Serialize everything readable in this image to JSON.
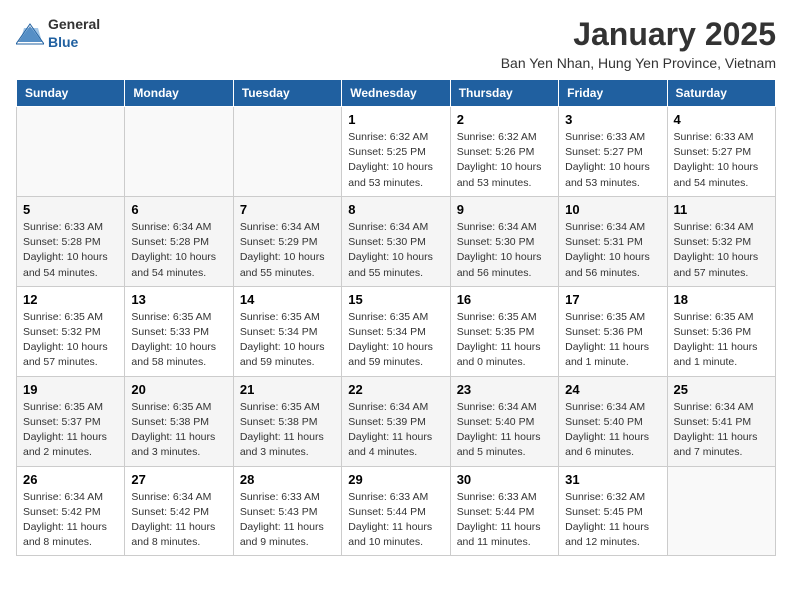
{
  "header": {
    "logo_general": "General",
    "logo_blue": "Blue",
    "month_title": "January 2025",
    "location": "Ban Yen Nhan, Hung Yen Province, Vietnam"
  },
  "days_of_week": [
    "Sunday",
    "Monday",
    "Tuesday",
    "Wednesday",
    "Thursday",
    "Friday",
    "Saturday"
  ],
  "weeks": [
    [
      {
        "day": "",
        "detail": ""
      },
      {
        "day": "",
        "detail": ""
      },
      {
        "day": "",
        "detail": ""
      },
      {
        "day": "1",
        "detail": "Sunrise: 6:32 AM\nSunset: 5:25 PM\nDaylight: 10 hours\nand 53 minutes."
      },
      {
        "day": "2",
        "detail": "Sunrise: 6:32 AM\nSunset: 5:26 PM\nDaylight: 10 hours\nand 53 minutes."
      },
      {
        "day": "3",
        "detail": "Sunrise: 6:33 AM\nSunset: 5:27 PM\nDaylight: 10 hours\nand 53 minutes."
      },
      {
        "day": "4",
        "detail": "Sunrise: 6:33 AM\nSunset: 5:27 PM\nDaylight: 10 hours\nand 54 minutes."
      }
    ],
    [
      {
        "day": "5",
        "detail": "Sunrise: 6:33 AM\nSunset: 5:28 PM\nDaylight: 10 hours\nand 54 minutes."
      },
      {
        "day": "6",
        "detail": "Sunrise: 6:34 AM\nSunset: 5:28 PM\nDaylight: 10 hours\nand 54 minutes."
      },
      {
        "day": "7",
        "detail": "Sunrise: 6:34 AM\nSunset: 5:29 PM\nDaylight: 10 hours\nand 55 minutes."
      },
      {
        "day": "8",
        "detail": "Sunrise: 6:34 AM\nSunset: 5:30 PM\nDaylight: 10 hours\nand 55 minutes."
      },
      {
        "day": "9",
        "detail": "Sunrise: 6:34 AM\nSunset: 5:30 PM\nDaylight: 10 hours\nand 56 minutes."
      },
      {
        "day": "10",
        "detail": "Sunrise: 6:34 AM\nSunset: 5:31 PM\nDaylight: 10 hours\nand 56 minutes."
      },
      {
        "day": "11",
        "detail": "Sunrise: 6:34 AM\nSunset: 5:32 PM\nDaylight: 10 hours\nand 57 minutes."
      }
    ],
    [
      {
        "day": "12",
        "detail": "Sunrise: 6:35 AM\nSunset: 5:32 PM\nDaylight: 10 hours\nand 57 minutes."
      },
      {
        "day": "13",
        "detail": "Sunrise: 6:35 AM\nSunset: 5:33 PM\nDaylight: 10 hours\nand 58 minutes."
      },
      {
        "day": "14",
        "detail": "Sunrise: 6:35 AM\nSunset: 5:34 PM\nDaylight: 10 hours\nand 59 minutes."
      },
      {
        "day": "15",
        "detail": "Sunrise: 6:35 AM\nSunset: 5:34 PM\nDaylight: 10 hours\nand 59 minutes."
      },
      {
        "day": "16",
        "detail": "Sunrise: 6:35 AM\nSunset: 5:35 PM\nDaylight: 11 hours\nand 0 minutes."
      },
      {
        "day": "17",
        "detail": "Sunrise: 6:35 AM\nSunset: 5:36 PM\nDaylight: 11 hours\nand 1 minute."
      },
      {
        "day": "18",
        "detail": "Sunrise: 6:35 AM\nSunset: 5:36 PM\nDaylight: 11 hours\nand 1 minute."
      }
    ],
    [
      {
        "day": "19",
        "detail": "Sunrise: 6:35 AM\nSunset: 5:37 PM\nDaylight: 11 hours\nand 2 minutes."
      },
      {
        "day": "20",
        "detail": "Sunrise: 6:35 AM\nSunset: 5:38 PM\nDaylight: 11 hours\nand 3 minutes."
      },
      {
        "day": "21",
        "detail": "Sunrise: 6:35 AM\nSunset: 5:38 PM\nDaylight: 11 hours\nand 3 minutes."
      },
      {
        "day": "22",
        "detail": "Sunrise: 6:34 AM\nSunset: 5:39 PM\nDaylight: 11 hours\nand 4 minutes."
      },
      {
        "day": "23",
        "detail": "Sunrise: 6:34 AM\nSunset: 5:40 PM\nDaylight: 11 hours\nand 5 minutes."
      },
      {
        "day": "24",
        "detail": "Sunrise: 6:34 AM\nSunset: 5:40 PM\nDaylight: 11 hours\nand 6 minutes."
      },
      {
        "day": "25",
        "detail": "Sunrise: 6:34 AM\nSunset: 5:41 PM\nDaylight: 11 hours\nand 7 minutes."
      }
    ],
    [
      {
        "day": "26",
        "detail": "Sunrise: 6:34 AM\nSunset: 5:42 PM\nDaylight: 11 hours\nand 8 minutes."
      },
      {
        "day": "27",
        "detail": "Sunrise: 6:34 AM\nSunset: 5:42 PM\nDaylight: 11 hours\nand 8 minutes."
      },
      {
        "day": "28",
        "detail": "Sunrise: 6:33 AM\nSunset: 5:43 PM\nDaylight: 11 hours\nand 9 minutes."
      },
      {
        "day": "29",
        "detail": "Sunrise: 6:33 AM\nSunset: 5:44 PM\nDaylight: 11 hours\nand 10 minutes."
      },
      {
        "day": "30",
        "detail": "Sunrise: 6:33 AM\nSunset: 5:44 PM\nDaylight: 11 hours\nand 11 minutes."
      },
      {
        "day": "31",
        "detail": "Sunrise: 6:32 AM\nSunset: 5:45 PM\nDaylight: 11 hours\nand 12 minutes."
      },
      {
        "day": "",
        "detail": ""
      }
    ]
  ]
}
